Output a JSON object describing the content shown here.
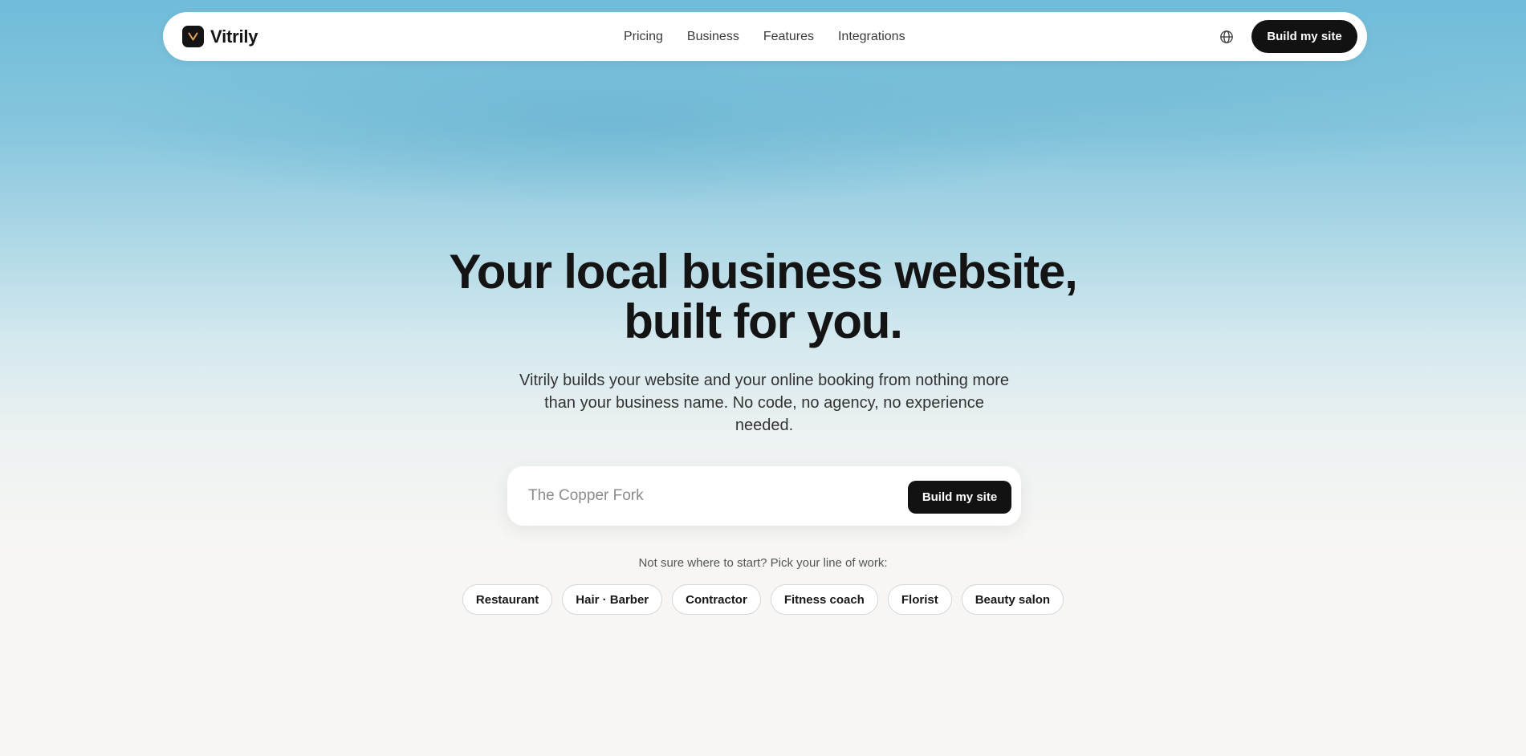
{
  "nav": {
    "brand": "Vitrily",
    "links": [
      "Pricing",
      "Business",
      "Features",
      "Integrations"
    ],
    "language_icon": "globe-icon",
    "cta_label": "Build my site"
  },
  "hero": {
    "headline_line1": "Your local business website,",
    "headline_line2": "built for you.",
    "subheadline": "Vitrily builds your website and your online booking from nothing more than your business name. No code, no agency, no experience needed."
  },
  "search": {
    "placeholder": "The Copper Fork",
    "cta_label": "Build my site"
  },
  "suggestions": {
    "prompt": "Not sure where to start? Pick your line of work:",
    "chips": [
      "Restaurant",
      "Hair · Barber",
      "Contractor",
      "Fitness coach",
      "Florist",
      "Beauty salon"
    ]
  },
  "colors": {
    "primary_dark": "#121212",
    "sky_top": "#6fbcd9",
    "page_bg": "#f7f6f4",
    "logo_accent": "#e8a05c"
  }
}
